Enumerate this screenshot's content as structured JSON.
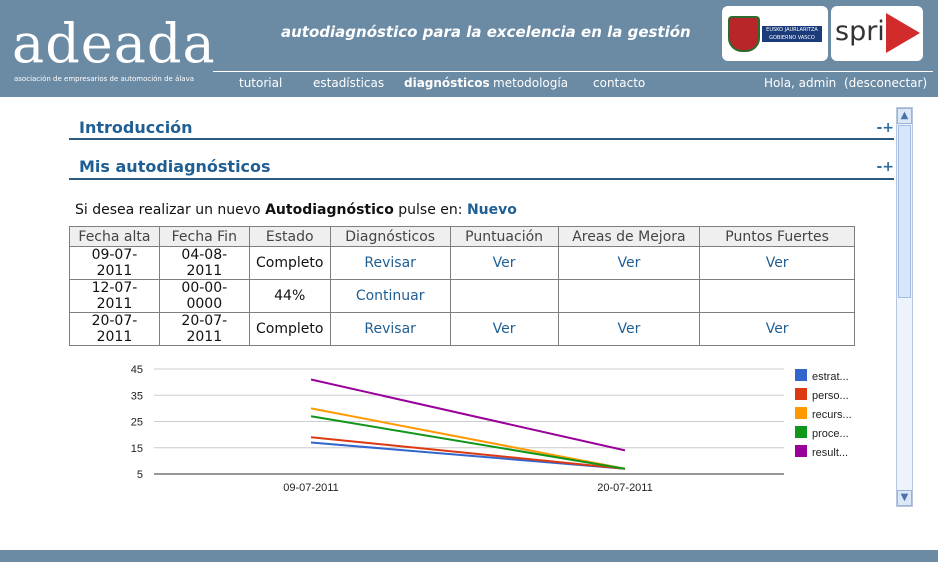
{
  "header": {
    "logo": "adeada",
    "logo_subtitle": "asociación de empresarios de automoción de álava",
    "tagline": "autodiagnóstico para la excelencia en la gestión",
    "partners": {
      "gov": "EUSKO JAURLARITZA GOBIERNO VASCO",
      "spri": "spri"
    }
  },
  "nav": {
    "tutorial": "tutorial",
    "estadisticas": "estadísticas",
    "diagnosticos": "diagnósticos",
    "metodologia": "metodología",
    "contacto": "contacto",
    "greeting": "Hola, admin",
    "logout": "(desconectar)"
  },
  "sections": {
    "intro_title": "Introducción",
    "my_title": "Mis autodiagnósticos",
    "expander": "-+"
  },
  "prompt": {
    "before": "Si desea realizar un nuevo",
    "bold": "Autodiagnóstico",
    "after": "pulse en:",
    "new_link": "Nuevo"
  },
  "table": {
    "headers": [
      "Fecha alta",
      "Fecha Fin",
      "Estado",
      "Diagnósticos",
      "Puntuación",
      "Areas de Mejora",
      "Puntos Fuertes"
    ],
    "rows": [
      [
        "09-07-2011",
        "04-08-2011",
        "Completo",
        "Revisar",
        "Ver",
        "Ver",
        "Ver"
      ],
      [
        "12-07-2011",
        "00-00-0000",
        "44%",
        "Continuar",
        "",
        "",
        ""
      ],
      [
        "20-07-2011",
        "20-07-2011",
        "Completo",
        "Revisar",
        "Ver",
        "Ver",
        "Ver"
      ]
    ]
  },
  "chart_data": {
    "type": "line",
    "title": "",
    "x": [
      "09-07-2011",
      "20-07-2011"
    ],
    "ylim": [
      5,
      45
    ],
    "yticks": [
      5,
      15,
      25,
      35,
      45
    ],
    "series": [
      {
        "name": "estrat...",
        "color": "#3366cc",
        "values": [
          17,
          7
        ]
      },
      {
        "name": "perso...",
        "color": "#dc3912",
        "values": [
          19,
          7
        ]
      },
      {
        "name": "recurs...",
        "color": "#ff9900",
        "values": [
          30,
          7
        ]
      },
      {
        "name": "proce...",
        "color": "#109618",
        "values": [
          27,
          7
        ]
      },
      {
        "name": "result...",
        "color": "#990099",
        "values": [
          41,
          14
        ]
      }
    ]
  }
}
